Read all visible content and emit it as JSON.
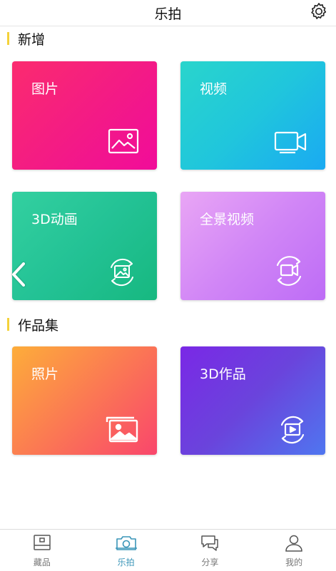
{
  "header": {
    "title": "乐拍",
    "settings_icon": "gear-icon"
  },
  "sections": {
    "new": {
      "title": "新增"
    },
    "works": {
      "title": "作品集"
    }
  },
  "cards": {
    "image": {
      "label": "图片",
      "icon": "image-icon",
      "colors": [
        "#fb2b6f",
        "#f10c9a"
      ]
    },
    "video": {
      "label": "视频",
      "icon": "video-camera-icon",
      "colors": [
        "#29d5cc",
        "#1aaaf2"
      ]
    },
    "anim3d": {
      "label": "3D动画",
      "icon": "rotate-image-icon",
      "colors": [
        "#33d0a0",
        "#17b880"
      ]
    },
    "panorama": {
      "label": "全景视频",
      "icon": "rotate-video-icon",
      "colors": [
        "#e9a6f5",
        "#bd6cf6"
      ]
    },
    "photos": {
      "label": "照片",
      "icon": "photo-stack-icon",
      "colors": [
        "#fdad3a",
        "#f9466c"
      ]
    },
    "works3d": {
      "label": "3D作品",
      "icon": "rotate-play-icon",
      "colors": [
        "#7a28e6",
        "#4f76f0"
      ]
    }
  },
  "navigation": {
    "back_icon": "chevron-left-icon"
  },
  "tabbar": {
    "active": "乐拍",
    "items": [
      {
        "label": "藏品",
        "icon": "collection-icon"
      },
      {
        "label": "乐拍",
        "icon": "camera-icon"
      },
      {
        "label": "分享",
        "icon": "share-chat-icon"
      },
      {
        "label": "我的",
        "icon": "user-icon"
      }
    ]
  },
  "colors": {
    "accent": "#3a95b8",
    "section_bar": "#f4d23a"
  }
}
